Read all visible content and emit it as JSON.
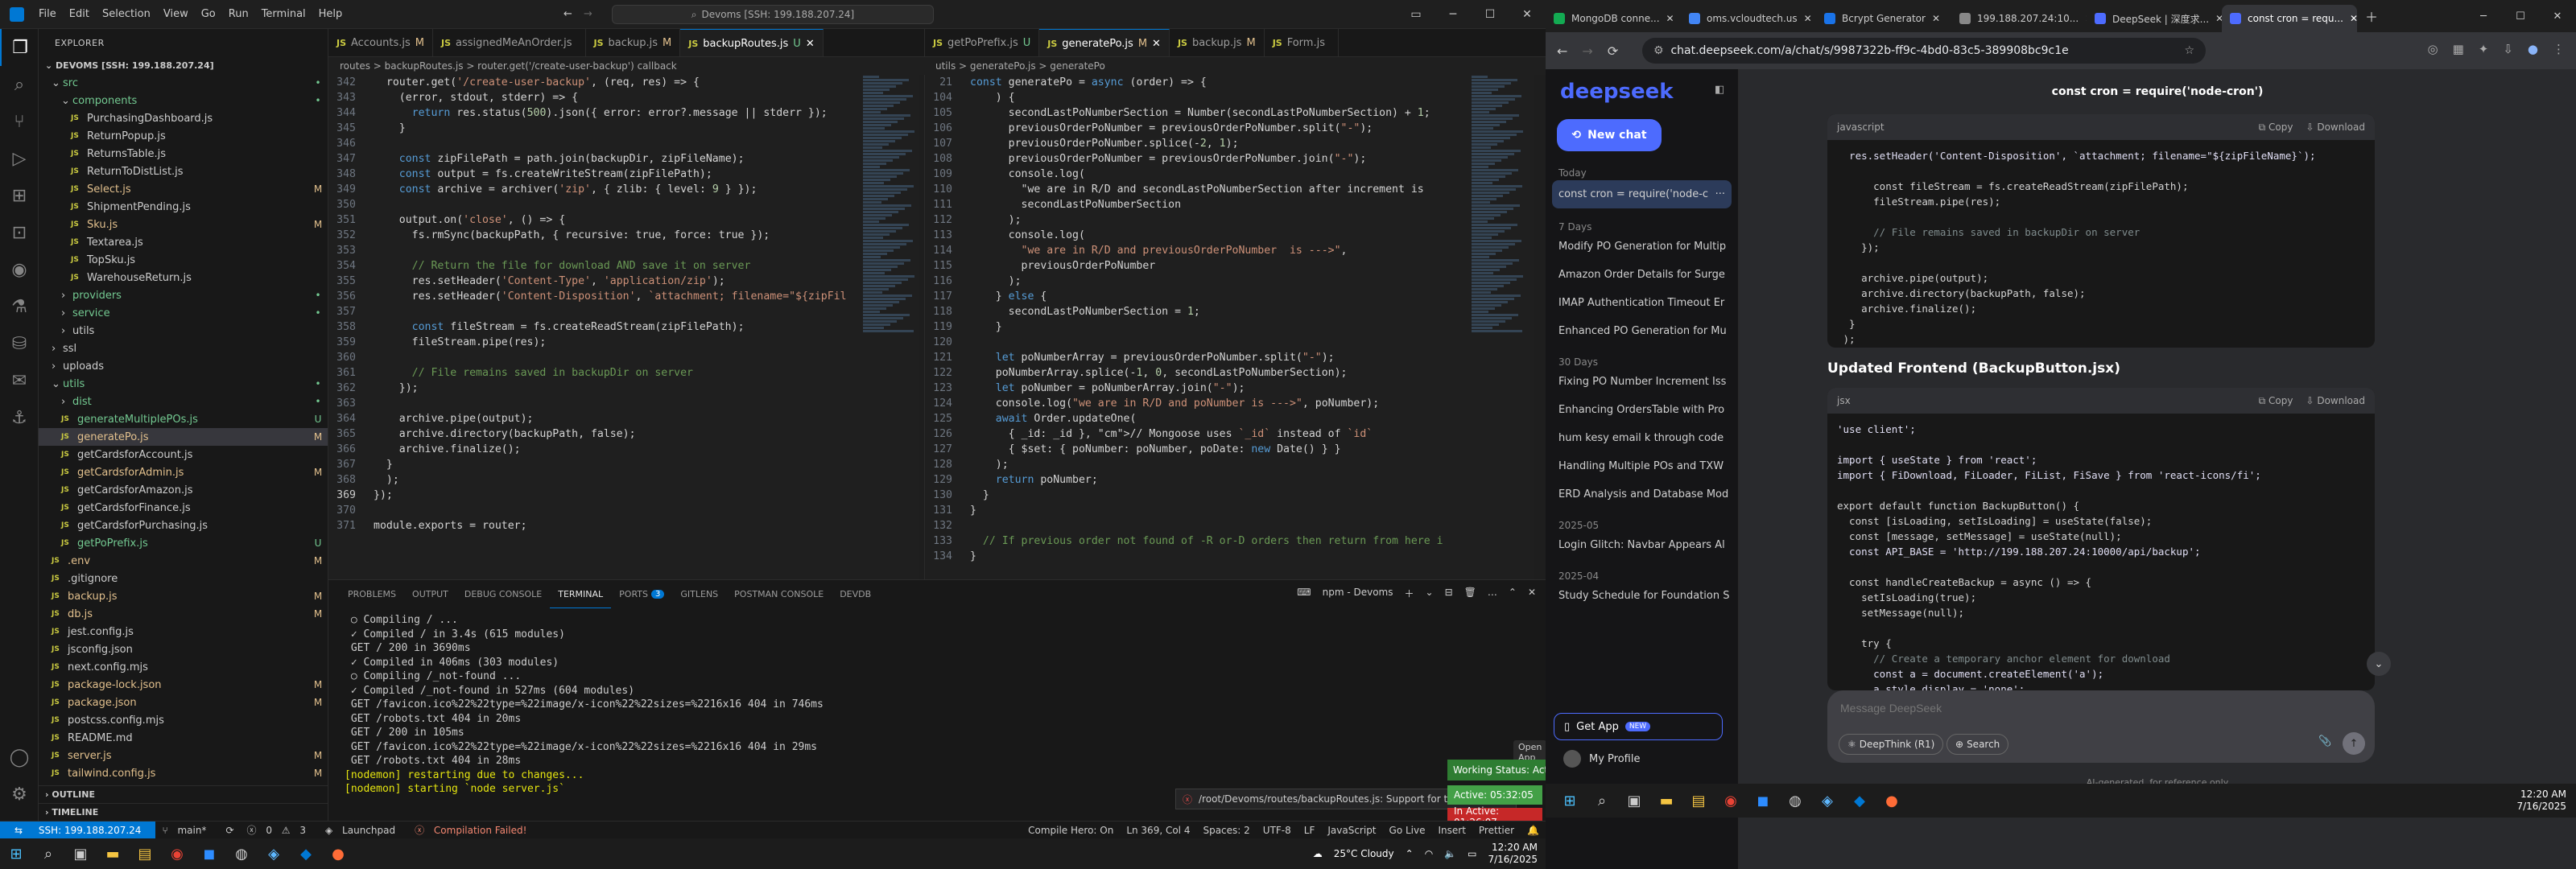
{
  "vscode": {
    "title_search": "Devoms [SSH: 199.188.207.24]",
    "menu": [
      "File",
      "Edit",
      "Selection",
      "View",
      "Go",
      "Run",
      "Terminal",
      "Help"
    ],
    "explorer": {
      "header": "EXPLORER",
      "root": "DEVOMS [SSH: 199.188.207.24]",
      "items": [
        {
          "label": "src",
          "status": "•",
          "cls": "c-dot"
        },
        {
          "label": "components",
          "status": "•",
          "cls": "c-dot"
        },
        {
          "label": "PurchasingDashboard.js",
          "status": "",
          "cls": ""
        },
        {
          "label": "ReturnPopup.js",
          "status": "",
          "cls": ""
        },
        {
          "label": "ReturnsTable.js",
          "status": "",
          "cls": ""
        },
        {
          "label": "ReturnToDistList.js",
          "status": "",
          "cls": ""
        },
        {
          "label": "Select.js",
          "status": "M",
          "cls": "c-m"
        },
        {
          "label": "ShipmentPending.js",
          "status": "",
          "cls": ""
        },
        {
          "label": "Sku.js",
          "status": "M",
          "cls": "c-m"
        },
        {
          "label": "Textarea.js",
          "status": "",
          "cls": ""
        },
        {
          "label": "TopSku.js",
          "status": "",
          "cls": ""
        },
        {
          "label": "WarehouseReturn.js",
          "status": "",
          "cls": ""
        },
        {
          "label": "providers",
          "status": "•",
          "cls": "c-dot"
        },
        {
          "label": "service",
          "status": "•",
          "cls": "c-dot"
        },
        {
          "label": "utils",
          "status": "",
          "cls": ""
        },
        {
          "label": "ssl",
          "status": "",
          "cls": ""
        },
        {
          "label": "uploads",
          "status": "",
          "cls": ""
        },
        {
          "label": "utils",
          "status": "•",
          "cls": "c-dot"
        },
        {
          "label": "dist",
          "status": "•",
          "cls": "c-dot"
        },
        {
          "label": "generateMultiplePOs.js",
          "status": "U",
          "cls": "c-u"
        },
        {
          "label": "generatePo.js",
          "status": "M",
          "cls": "c-m"
        },
        {
          "label": "getCardsforAccount.js",
          "status": "",
          "cls": ""
        },
        {
          "label": "getCardsforAdmin.js",
          "status": "M",
          "cls": "c-m"
        },
        {
          "label": "getCardsforAmazon.js",
          "status": "",
          "cls": ""
        },
        {
          "label": "getCardsforFinance.js",
          "status": "",
          "cls": ""
        },
        {
          "label": "getCardsforPurchasing.js",
          "status": "",
          "cls": ""
        },
        {
          "label": "getPoPrefix.js",
          "status": "U",
          "cls": "c-u"
        },
        {
          "label": ".env",
          "status": "M",
          "cls": "c-m"
        },
        {
          "label": ".gitignore",
          "status": "",
          "cls": ""
        },
        {
          "label": "backup.js",
          "status": "M",
          "cls": "c-m"
        },
        {
          "label": "db.js",
          "status": "M",
          "cls": "c-m"
        },
        {
          "label": "jest.config.js",
          "status": "",
          "cls": ""
        },
        {
          "label": "jsconfig.json",
          "status": "",
          "cls": ""
        },
        {
          "label": "next.config.mjs",
          "status": "",
          "cls": ""
        },
        {
          "label": "package-lock.json",
          "status": "M",
          "cls": "c-m"
        },
        {
          "label": "package.json",
          "status": "M",
          "cls": "c-m"
        },
        {
          "label": "postcss.config.mjs",
          "status": "",
          "cls": ""
        },
        {
          "label": "README.md",
          "status": "",
          "cls": ""
        },
        {
          "label": "server.js",
          "status": "M",
          "cls": "c-m"
        },
        {
          "label": "tailwind.config.js",
          "status": "M",
          "cls": "c-m"
        }
      ],
      "outline": "OUTLINE",
      "timeline": "TIMELINE"
    },
    "left_tabs": [
      {
        "label": "Accounts.js",
        "st": "M"
      },
      {
        "label": "assignedMeAnOrder.js",
        "st": ""
      },
      {
        "label": "backup.js",
        "st": "M"
      },
      {
        "label": "backupRoutes.js",
        "st": "U"
      }
    ],
    "left_crumbs": "routes > backupRoutes.js > router.get('/create-user-backup') callback",
    "right_tabs": [
      {
        "label": "getPoPrefix.js",
        "st": "U"
      },
      {
        "label": "generatePo.js",
        "st": "M"
      },
      {
        "label": "backup.js",
        "st": "M"
      },
      {
        "label": "Form.js",
        "st": ""
      }
    ],
    "right_crumbs": "utils > generatePo.js > generatePo",
    "panel_tabs": [
      "PROBLEMS",
      "OUTPUT",
      "DEBUG CONSOLE",
      "TERMINAL",
      "PORTS",
      "GITLENS",
      "POSTMAN CONSOLE",
      "DEVDB"
    ],
    "ports_badge": "3",
    "terminal_task": "npm - Devoms",
    "terminal": [
      " ○ Compiling / ...",
      " ✓ Compiled / in 3.4s (615 modules)",
      " GET / 200 in 3690ms",
      " ✓ Compiled in 406ms (303 modules)",
      " ○ Compiling /_not-found ...",
      " ✓ Compiled /_not-found in 527ms (604 modules)",
      " GET /favicon.ico%22%22type=%22image/x-icon%22%22sizes=%2216x16 404 in 746ms",
      " GET /robots.txt 404 in 20ms",
      " GET / 200 in 105ms",
      " GET /favicon.ico%22%22type=%22image/x-icon%22%22sizes=%2216x16 404 in 29ms",
      " GET /robots.txt 404 in 28ms",
      "[nodemon] restarting due to changes...",
      "[nodemon] starting `node server.js`"
    ],
    "status": {
      "remote": "SSH: 199.188.207.24",
      "branch": "main*",
      "errors": "0",
      "warnings": "3",
      "launchpad": "Launchpad",
      "compile": "Compilation Failed!",
      "compile_hero": "Compile Hero: On",
      "position": "Ln 369, Col 4",
      "spaces": "Spaces: 2",
      "encoding": "UTF-8",
      "eol": "LF",
      "lang": "JavaScript",
      "golive": "Go Live",
      "insert": "Insert",
      "prettier": "Prettier"
    },
    "toast_path": "/root/Devoms/routes/backupRoutes.js: Support for t...",
    "toast_open": "Open App",
    "work_status": "Working Status: Active",
    "active_time": "Active: 05:32:05",
    "inactive_time": "In Active: 01:26:07",
    "weather": "25°C  Cloudy",
    "clock_time": "12:20 AM",
    "clock_date": "7/16/2025"
  },
  "browser": {
    "tabs": [
      {
        "label": "MongoDB conne...",
        "color": "#13aa52"
      },
      {
        "label": "oms.vcloudtech.us",
        "color": "#4285f4"
      },
      {
        "label": "Bcrypt Generator",
        "color": "#1a73e8"
      },
      {
        "label": "199.188.207.24:10...",
        "color": "#888888"
      },
      {
        "label": "DeepSeek | 深度求...",
        "color": "#4d6bfe"
      },
      {
        "label": "const cron = requ...",
        "color": "#4d6bfe"
      }
    ],
    "url": "chat.deepseek.com/a/chat/s/9987322b-ff9c-4bd0-83c5-389908bc9c1e",
    "sidebar": {
      "logo": "deepseek",
      "new_chat": "New chat",
      "today": "Today",
      "current": "const cron = require('node-c",
      "g7": "7 Days",
      "items7": [
        "Modify PO Generation for Multip",
        "Amazon Order Details for Surge",
        "IMAP Authentication Timeout Er",
        "Enhanced PO Generation for Mu"
      ],
      "g30": "30 Days",
      "items30": [
        "Fixing PO Number Increment Iss",
        "Enhancing OrdersTable with Pro",
        "hum kesy email k through code",
        "Handling Multiple POs and TXW",
        "ERD Analysis and Database Mod"
      ],
      "g05": "2025-05",
      "items05": [
        "Login Glitch: Navbar Appears Al"
      ],
      "g04": "2025-04",
      "items04": [
        "Study Schedule for Foundation S"
      ],
      "get_app": "Get App",
      "new_badge": "NEW",
      "profile": "My Profile"
    },
    "chat_title": "const cron = require('node-cron')",
    "block1_lang": "javascript",
    "copy": "Copy",
    "download": "Download",
    "block1": [
      "  res.setHeader('Content-Disposition', `attachment; filename=\"${zipFileName}`);",
      "",
      "      const fileStream = fs.createReadStream(zipFilePath);",
      "      fileStream.pipe(res);",
      "",
      "      // File remains saved in backupDir on server",
      "    });",
      "",
      "    archive.pipe(output);",
      "    archive.directory(backupPath, false);",
      "    archive.finalize();",
      "  }",
      " );",
      "});"
    ],
    "heading": "Updated Frontend (BackupButton.jsx)",
    "block2_lang": "jsx",
    "block2": [
      "'use client';",
      "",
      "import { useState } from 'react';",
      "import { FiDownload, FiLoader, FiList, FiSave } from 'react-icons/fi';",
      "",
      "export default function BackupButton() {",
      "  const [isLoading, setIsLoading] = useState(false);",
      "  const [message, setMessage] = useState(null);",
      "  const API_BASE = 'http://199.188.207.24:10000/api/backup';",
      "",
      "  const handleCreateBackup = async () => {",
      "    setIsLoading(true);",
      "    setMessage(null);",
      "",
      "    try {",
      "      // Create a temporary anchor element for download",
      "      const a = document.createElement('a');",
      "      a.style.display = 'none';"
    ],
    "input_placeholder": "Message DeepSeek",
    "deepthink": "DeepThink (R1)",
    "search": "Search",
    "disclaimer": "AI-generated, for reference only",
    "clock_time": "12:20 AM",
    "clock_date": "7/16/2025"
  },
  "left_code": [
    {
      "n": "342",
      "t": "  router.get('/create-user-backup', (req, res) => {"
    },
    {
      "n": "343",
      "t": "    (error, stdout, stderr) => {"
    },
    {
      "n": "344",
      "t": "      return res.status(500).json({ error: error?.message || stderr });"
    },
    {
      "n": "345",
      "t": "    }"
    },
    {
      "n": "346",
      "t": ""
    },
    {
      "n": "347",
      "t": "    const zipFilePath = path.join(backupDir, zipFileName);"
    },
    {
      "n": "348",
      "t": "    const output = fs.createWriteStream(zipFilePath);"
    },
    {
      "n": "349",
      "t": "    const archive = archiver('zip', { zlib: { level: 9 } });"
    },
    {
      "n": "350",
      "t": ""
    },
    {
      "n": "351",
      "t": "    output.on('close', () => {"
    },
    {
      "n": "352",
      "t": "      fs.rmSync(backupPath, { recursive: true, force: true });"
    },
    {
      "n": "353",
      "t": ""
    },
    {
      "n": "354",
      "t": "      // Return the file for download AND save it on server"
    },
    {
      "n": "355",
      "t": "      res.setHeader('Content-Type', 'application/zip');"
    },
    {
      "n": "356",
      "t": "      res.setHeader('Content-Disposition', `attachment; filename=\"${zipFil"
    },
    {
      "n": "357",
      "t": ""
    },
    {
      "n": "358",
      "t": "      const fileStream = fs.createReadStream(zipFilePath);"
    },
    {
      "n": "359",
      "t": "      fileStream.pipe(res);"
    },
    {
      "n": "360",
      "t": ""
    },
    {
      "n": "361",
      "t": "      // File remains saved in backupDir on server"
    },
    {
      "n": "362",
      "t": "    });"
    },
    {
      "n": "363",
      "t": ""
    },
    {
      "n": "364",
      "t": "    archive.pipe(output);"
    },
    {
      "n": "365",
      "t": "    archive.directory(backupPath, false);"
    },
    {
      "n": "366",
      "t": "    archive.finalize();"
    },
    {
      "n": "367",
      "t": "  }"
    },
    {
      "n": "368",
      "t": "  );"
    },
    {
      "n": "369",
      "t": "});"
    },
    {
      "n": "370",
      "t": ""
    },
    {
      "n": "371",
      "t": "module.exports = router;"
    }
  ],
  "right_code": [
    {
      "n": "21",
      "t": "const generatePo = async (order) => {"
    },
    {
      "n": "104",
      "t": "    ) {"
    },
    {
      "n": "105",
      "t": "      secondLastPoNumberSection = Number(secondLastPoNumberSection) + 1;"
    },
    {
      "n": "106",
      "t": "      previousOrderPoNumber = previousOrderPoNumber.split(\"-\");"
    },
    {
      "n": "107",
      "t": "      previousOrderPoNumber.splice(-2, 1);"
    },
    {
      "n": "108",
      "t": "      previousOrderPoNumber = previousOrderPoNumber.join(\"-\");"
    },
    {
      "n": "109",
      "t": "      console.log("
    },
    {
      "n": "110",
      "t": "        \"we are in R/D and secondLastPoNumberSection after increment is"
    },
    {
      "n": "111",
      "t": "        secondLastPoNumberSection"
    },
    {
      "n": "112",
      "t": "      );"
    },
    {
      "n": "113",
      "t": "      console.log("
    },
    {
      "n": "114",
      "t": "        \"we are in R/D and previousOrderPoNumber  is --->\","
    },
    {
      "n": "115",
      "t": "        previousOrderPoNumber"
    },
    {
      "n": "116",
      "t": "      );"
    },
    {
      "n": "117",
      "t": "    } else {"
    },
    {
      "n": "118",
      "t": "      secondLastPoNumberSection = 1;"
    },
    {
      "n": "119",
      "t": "    }"
    },
    {
      "n": "120",
      "t": ""
    },
    {
      "n": "121",
      "t": "    let poNumberArray = previousOrderPoNumber.split(\"-\");"
    },
    {
      "n": "122",
      "t": "    poNumberArray.splice(-1, 0, secondLastPoNumberSection);"
    },
    {
      "n": "123",
      "t": "    let poNumber = poNumberArray.join(\"-\");"
    },
    {
      "n": "124",
      "t": "    console.log(\"we are in R/D and poNumber is --->\", poNumber);"
    },
    {
      "n": "125",
      "t": "    await Order.updateOne("
    },
    {
      "n": "126",
      "t": "      { _id: _id }, // Mongoose uses `_id` instead of `id`"
    },
    {
      "n": "127",
      "t": "      { $set: { poNumber: poNumber, poDate: new Date() } }"
    },
    {
      "n": "128",
      "t": "    );"
    },
    {
      "n": "129",
      "t": "    return poNumber;"
    },
    {
      "n": "130",
      "t": "  }"
    },
    {
      "n": "131",
      "t": "}"
    },
    {
      "n": "132",
      "t": ""
    },
    {
      "n": "133",
      "t": "  // If previous order not found of -R or-D orders then return from here i"
    },
    {
      "n": "134",
      "t": "}"
    }
  ]
}
